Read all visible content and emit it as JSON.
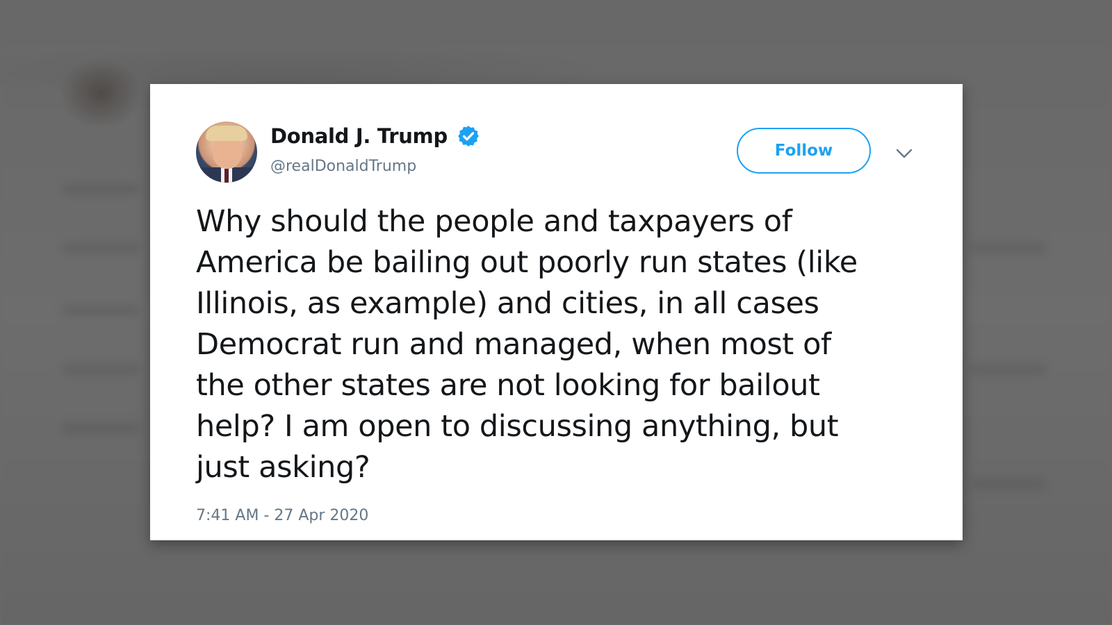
{
  "tweet": {
    "display_name": "Donald J. Trump",
    "handle": "@realDonaldTrump",
    "verified": true,
    "follow_label": "Follow",
    "text_lines": [
      "Why should the people and taxpayers of",
      "America be bailing out poorly run states (like",
      "Illinois, as example) and cities, in all cases",
      "Democrat run and managed, when most of",
      "the other states are not looking for bailout",
      "help? I am open to discussing anything, but",
      "just asking?"
    ],
    "timestamp": "7:41 AM - 27 Apr 2020"
  },
  "icons": {
    "verified": "verified-badge-icon",
    "menu": "chevron-down-icon"
  },
  "colors": {
    "accent": "#1da1f2",
    "text_primary": "#14171a",
    "text_secondary": "#657786",
    "card_background": "#ffffff",
    "backdrop": "#6b6b6b"
  }
}
